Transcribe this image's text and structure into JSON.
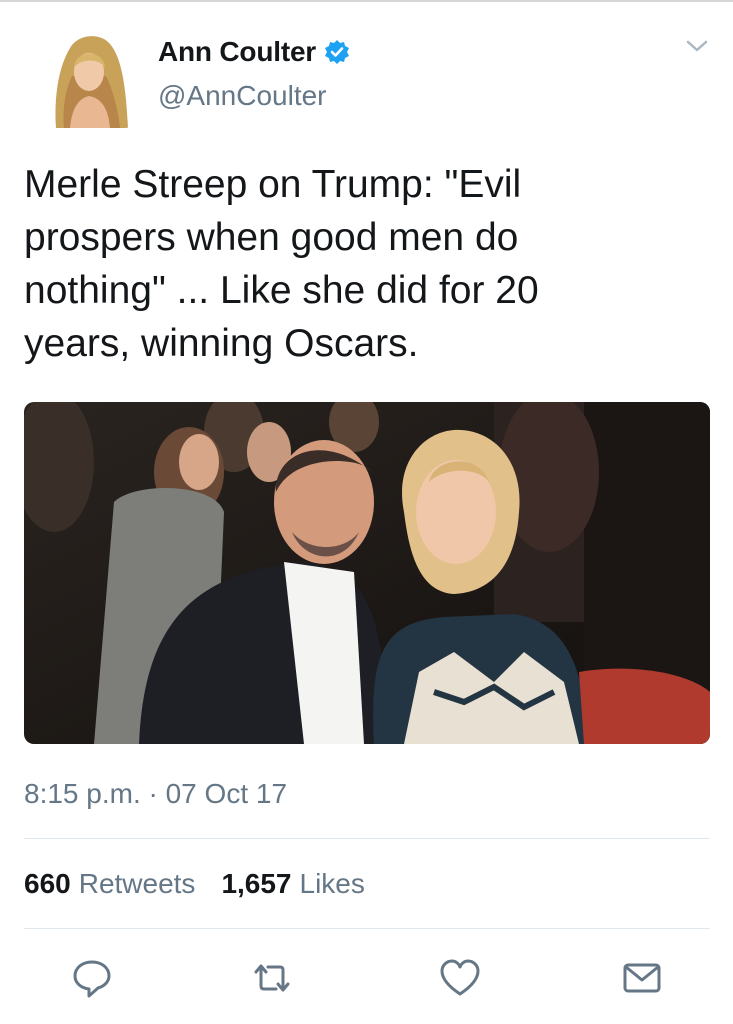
{
  "author": {
    "name": "Ann Coulter",
    "handle": "@AnnCoulter",
    "verified_icon": "verified-badge-icon"
  },
  "tweet": {
    "text": "Merle Streep on Trump: \"Evil\nprospers when good men do\nnothing\" ... Like she did for 20\nyears, winning Oscars.",
    "timestamp": "8:15 p.m. · 07 Oct 17"
  },
  "stats": {
    "retweets_count": "660",
    "retweets_label": "Retweets",
    "likes_count": "1,657",
    "likes_label": "Likes"
  },
  "actions": [
    "reply-icon",
    "retweet-icon",
    "like-icon",
    "share-icon"
  ],
  "colors": {
    "verified_blue": "#1da1f2",
    "text_primary": "#14171a",
    "text_secondary": "#657786"
  }
}
